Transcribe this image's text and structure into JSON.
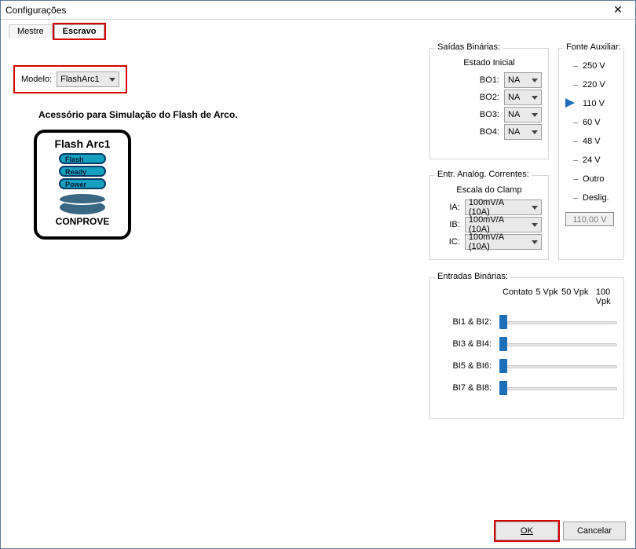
{
  "window": {
    "title": "Configurações"
  },
  "tabs": {
    "mestre": "Mestre",
    "escravo": "Escravo"
  },
  "model": {
    "label": "Modelo:",
    "value": "FlashArc1"
  },
  "description": "Acessório para Simulação do Flash de Arco.",
  "device": {
    "title": "Flash Arc1",
    "pill1": "Flash",
    "pill2": "Ready",
    "pill3": "Power",
    "brand": "CONPROVE"
  },
  "bo": {
    "title": "Saídas Binárias:",
    "subtitle": "Estado Inicial",
    "rows": [
      {
        "label": "BO1:",
        "value": "NA"
      },
      {
        "label": "BO2:",
        "value": "NA"
      },
      {
        "label": "BO3:",
        "value": "NA"
      },
      {
        "label": "BO4:",
        "value": "NA"
      }
    ]
  },
  "ai": {
    "title": "Entr. Analóg. Correntes:",
    "subtitle": "Escala do Clamp",
    "rows": [
      {
        "label": "IA:",
        "value": "100mV/A (10A)"
      },
      {
        "label": "IB:",
        "value": "100mV/A (10A)"
      },
      {
        "label": "IC:",
        "value": "100mV/A (10A)"
      }
    ]
  },
  "aux": {
    "title": "Fonte Auxiliar:",
    "options": [
      "250 V",
      "220 V",
      "110 V",
      "60 V",
      "48 V",
      "24 V",
      "Outro",
      "Deslig."
    ],
    "selected_index": 2,
    "input_value": "110,00 V"
  },
  "bi": {
    "title": "Entradas Binárias:",
    "headers": [
      "Contato",
      "5 Vpk",
      "50 Vpk",
      "100 Vpk"
    ],
    "rows": [
      "BI1 & BI2:",
      "BI3 & BI4:",
      "BI5 & BI6:",
      "BI7 & BI8:"
    ]
  },
  "buttons": {
    "ok": "OK",
    "cancel": "Cancelar"
  }
}
